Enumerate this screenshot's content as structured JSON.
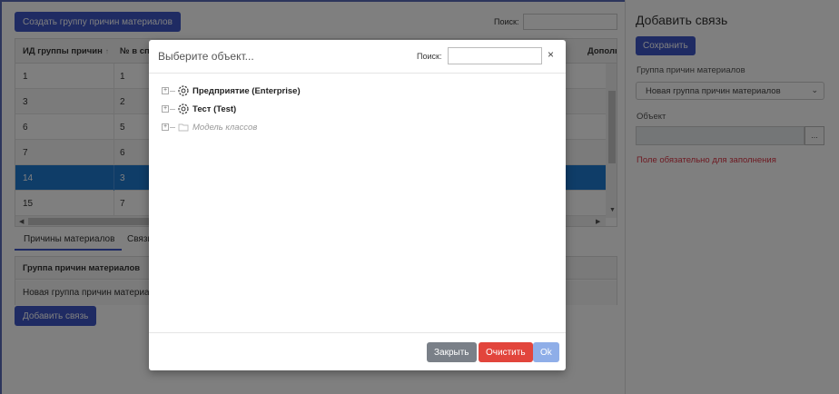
{
  "toolbar": {
    "create_group_label": "Создать группу причин материалов",
    "search_label": "Поиск:"
  },
  "grid": {
    "columns": [
      "ИД группы причин",
      "№ в сп",
      "Дополн"
    ],
    "sort_indicator": "↑",
    "rows": [
      {
        "id": "1",
        "num": "1"
      },
      {
        "id": "3",
        "num": "2"
      },
      {
        "id": "6",
        "num": "5"
      },
      {
        "id": "7",
        "num": "6"
      },
      {
        "id": "14",
        "num": "3"
      },
      {
        "id": "15",
        "num": "7"
      }
    ],
    "selected_row_index": 4
  },
  "tabs": [
    {
      "label": "Причины материалов"
    },
    {
      "label": "Связи"
    }
  ],
  "subgrid": {
    "column": "Группа причин материалов",
    "row_value": "Новая группа причин материалов"
  },
  "add_link_label": "Добавить связь",
  "sidepanel": {
    "title": "Добавить связь",
    "save_label": "Сохранить",
    "group_label": "Группа причин материалов",
    "group_value": "Новая группа причин материалов",
    "object_label": "Объект",
    "object_button": "...",
    "error_text": "Поле обязательно для заполнения"
  },
  "modal": {
    "title": "Выберите объект...",
    "search_label": "Поиск:",
    "close_glyph": "×",
    "tree": [
      {
        "label": "Предприятие (Enterprise)",
        "icon": "gear-icon",
        "style": "bold"
      },
      {
        "label": "Тест (Test)",
        "icon": "gear-icon",
        "style": "bold"
      },
      {
        "label": "Модель классов",
        "icon": "folder-icon",
        "style": "muted"
      }
    ],
    "buttons": {
      "close": "Закрыть",
      "clear": "Очистить",
      "ok": "Ok"
    }
  },
  "colors": {
    "primary": "#3f57c7",
    "selected_row": "#1f7ad1",
    "danger": "#e2453c",
    "error_text": "#dc3545"
  }
}
